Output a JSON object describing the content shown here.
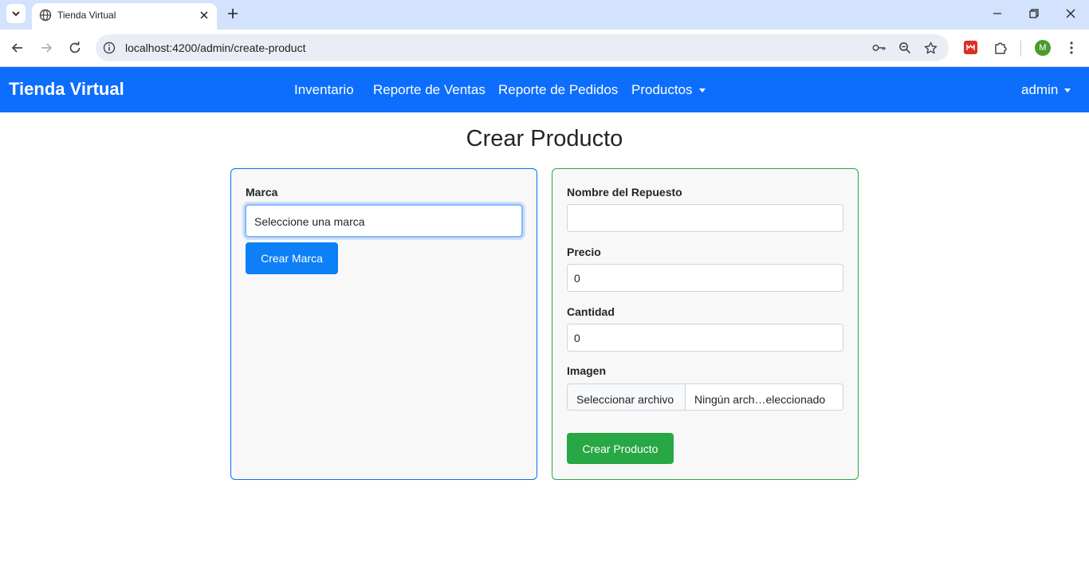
{
  "browser": {
    "tab_title": "Tienda Virtual",
    "url": "localhost:4200/admin/create-product",
    "profile_initial": "M"
  },
  "navbar": {
    "brand": "Tienda Virtual",
    "links": [
      "Inventario",
      "Reporte de Ventas",
      "Reporte de Pedidos",
      "Productos"
    ],
    "user": "admin"
  },
  "page": {
    "title": "Crear Producto"
  },
  "brand_form": {
    "label": "Marca",
    "select_value": "Seleccione una marca",
    "button": "Crear Marca"
  },
  "product_form": {
    "name_label": "Nombre del Repuesto",
    "name_value": "",
    "price_label": "Precio",
    "price_value": "0",
    "qty_label": "Cantidad",
    "qty_value": "0",
    "image_label": "Imagen",
    "file_button": "Seleccionar archivo",
    "file_status": "Ningún arch…eleccionado",
    "submit": "Crear Producto"
  },
  "colors": {
    "navbar": "#0d6efd",
    "brand_card_border": "#0d6efd",
    "product_card_border": "#28a745",
    "primary_button": "#0d7ff7",
    "success_button": "#28a745"
  }
}
